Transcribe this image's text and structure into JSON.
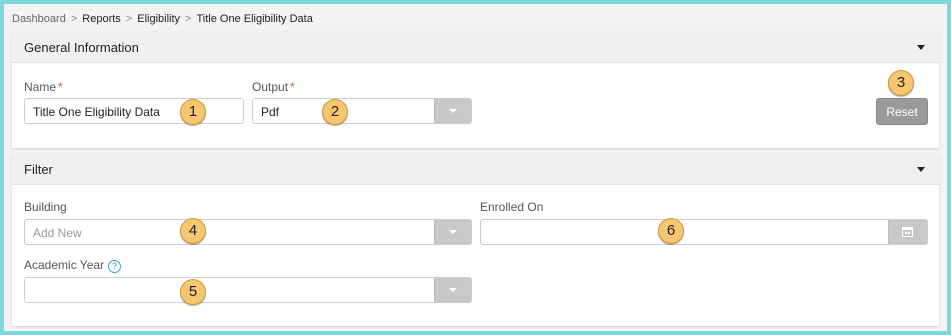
{
  "breadcrumb": {
    "items": [
      "Dashboard",
      "Reports",
      "Eligibility",
      "Title One Eligibility Data"
    ],
    "separator": ">"
  },
  "general": {
    "title": "General Information",
    "name_label": "Name",
    "name_value": "Title One Eligibility Data",
    "output_label": "Output",
    "output_value": "Pdf",
    "required_mark": "*",
    "reset_label": "Reset"
  },
  "filter": {
    "title": "Filter",
    "building_label": "Building",
    "building_placeholder": "Add New",
    "enrolled_label": "Enrolled On",
    "enrolled_value": "",
    "academic_year_label": "Academic Year",
    "academic_year_value": "",
    "help_glyph": "?"
  },
  "callouts": [
    "1",
    "2",
    "3",
    "4",
    "5",
    "6"
  ],
  "colors": {
    "border_frame": "#7fd8dc",
    "callout_fill": "#f6c670",
    "reset_button": "#9a9a9a",
    "required": "#d9534f",
    "help": "#3a9ad9"
  },
  "icons": [
    "chevron-down-icon",
    "calendar-icon",
    "help-icon"
  ]
}
